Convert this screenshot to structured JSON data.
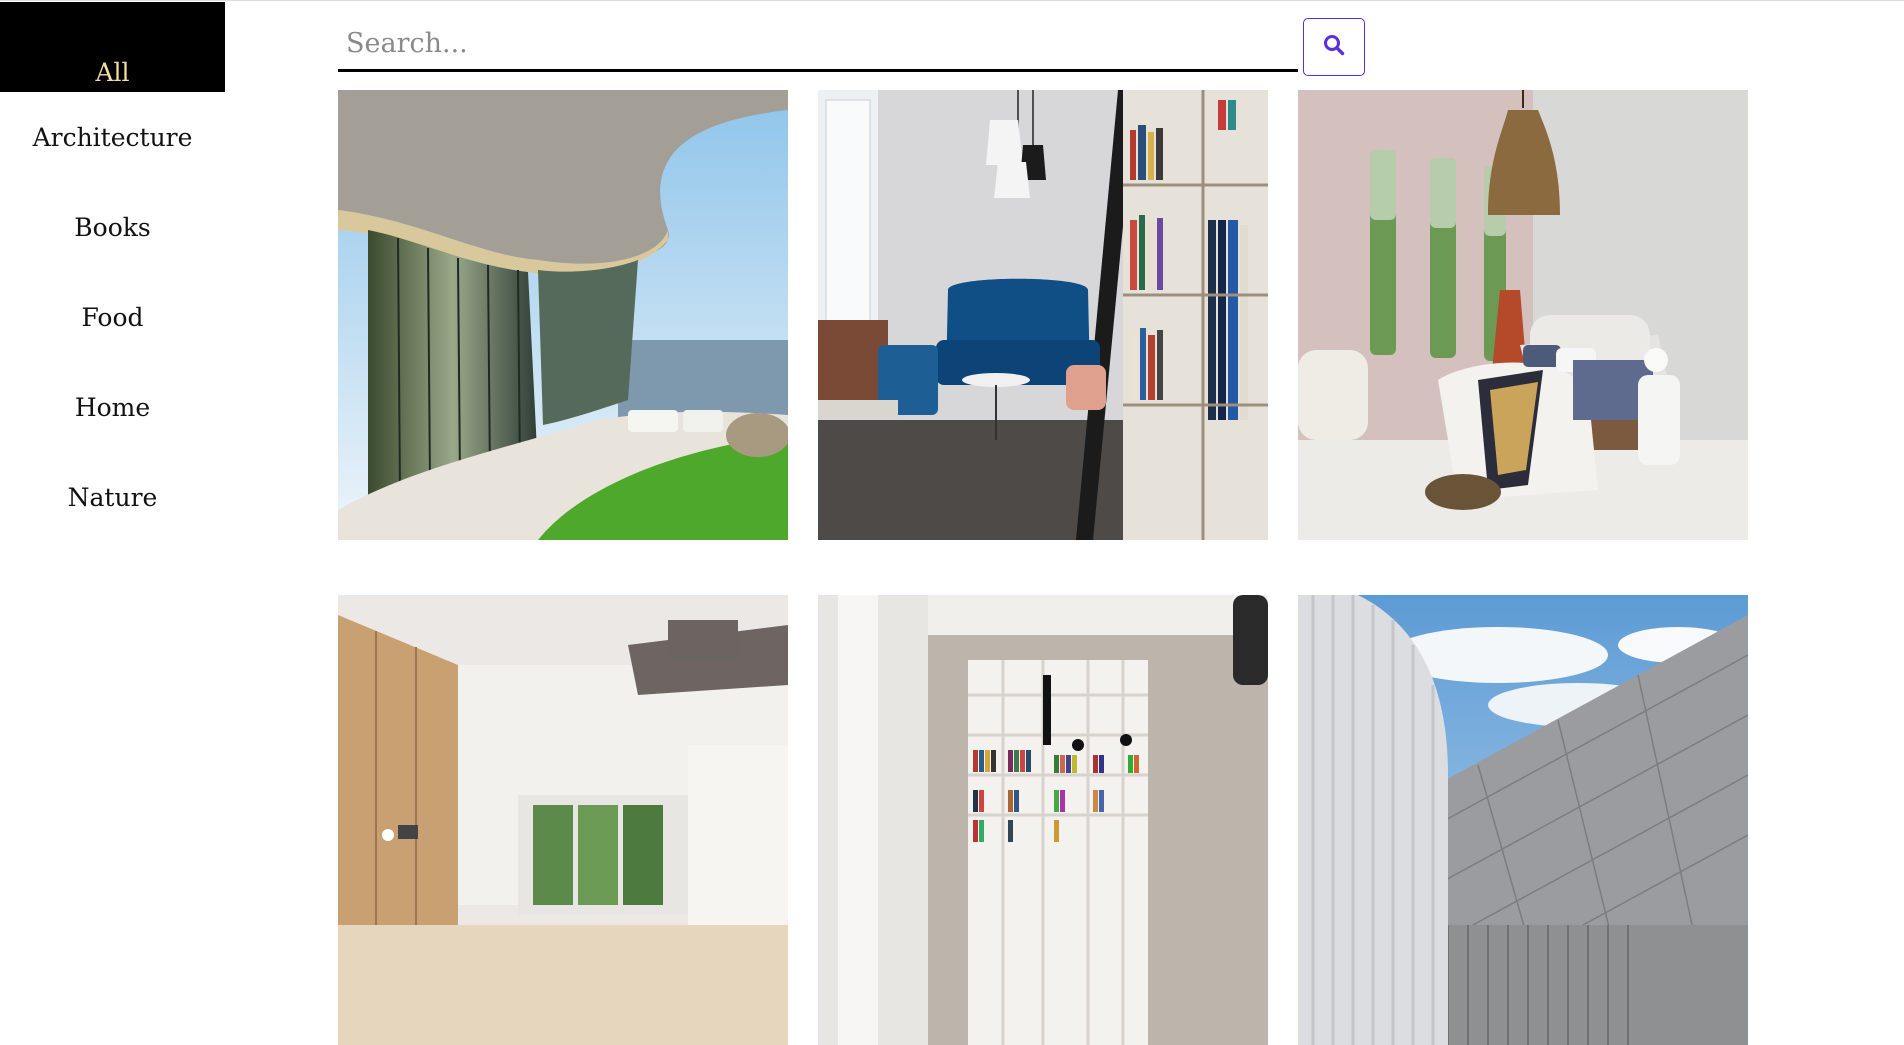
{
  "sidebar": {
    "items": [
      {
        "label": "All",
        "active": true
      },
      {
        "label": "Architecture"
      },
      {
        "label": "Books"
      },
      {
        "label": "Food"
      },
      {
        "label": "Home"
      },
      {
        "label": "Nature"
      }
    ]
  },
  "search": {
    "placeholder": "Search...",
    "value": "",
    "button_icon": "search-icon"
  },
  "colors": {
    "accent": "#5b2ee0",
    "active_bg": "#000000",
    "active_text": "#f2dfa0"
  },
  "gallery": {
    "images": [
      {
        "subject": "architecture-curved-glass-house"
      },
      {
        "subject": "library-lounge-blue-sofa"
      },
      {
        "subject": "bedroom-pink-walls"
      },
      {
        "subject": "modern-kitchen"
      },
      {
        "subject": "white-bookshelf-room"
      },
      {
        "subject": "architecture-facade-sky"
      }
    ]
  }
}
